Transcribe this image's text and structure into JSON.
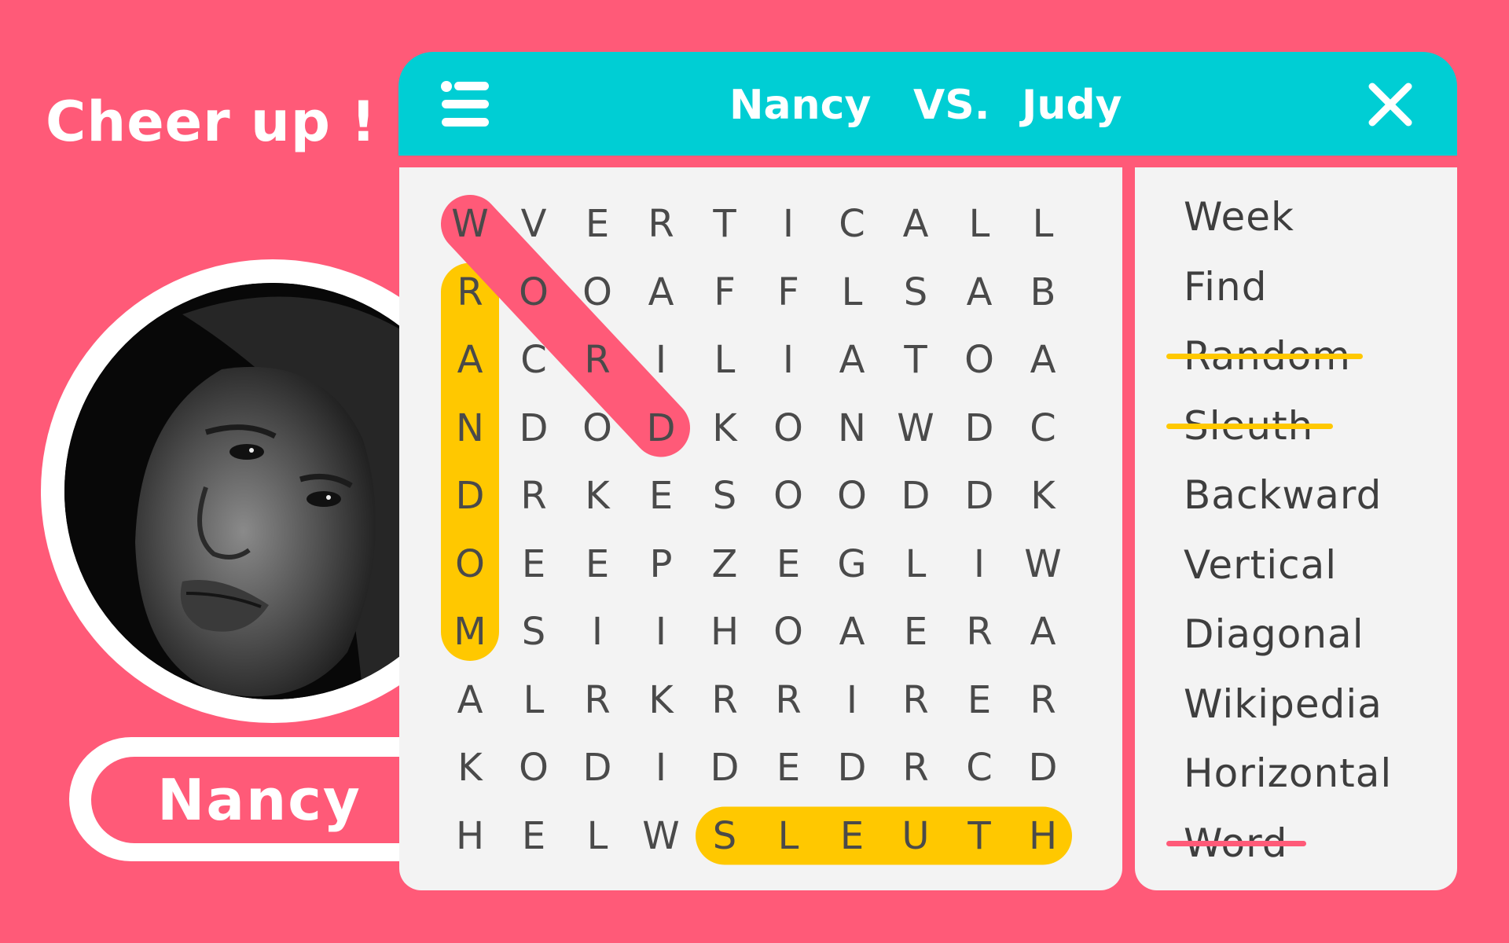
{
  "cheer_text": "Cheer up !",
  "header": {
    "player_one": "Nancy",
    "versus": "VS.",
    "player_two": "Judy"
  },
  "player_card": {
    "name": "Nancy"
  },
  "icons": {
    "menu": "menu-icon",
    "close": "close-icon",
    "avatar": "player-photo"
  },
  "colors": {
    "background": "#ff5a78",
    "header": "#00ced4",
    "panel": "#f3f3f3",
    "highlight_yellow": "#ffc800",
    "highlight_pink": "#ff5a78",
    "letter": "#4a4a4a"
  },
  "grid": [
    [
      "W",
      "V",
      "E",
      "R",
      "T",
      "I",
      "C",
      "A",
      "L",
      "L"
    ],
    [
      "R",
      "O",
      "O",
      "A",
      "F",
      "F",
      "L",
      "S",
      "A",
      "B"
    ],
    [
      "A",
      "C",
      "R",
      "I",
      "L",
      "I",
      "A",
      "T",
      "O",
      "A"
    ],
    [
      "N",
      "D",
      "O",
      "D",
      "K",
      "O",
      "N",
      "W",
      "D",
      "C"
    ],
    [
      "D",
      "R",
      "K",
      "E",
      "S",
      "O",
      "O",
      "D",
      "D",
      "K"
    ],
    [
      "O",
      "E",
      "E",
      "P",
      "Z",
      "E",
      "G",
      "L",
      "I",
      "W"
    ],
    [
      "M",
      "S",
      "I",
      "I",
      "H",
      "O",
      "A",
      "E",
      "R",
      "A"
    ],
    [
      "A",
      "L",
      "R",
      "K",
      "R",
      "R",
      "I",
      "R",
      "E",
      "R"
    ],
    [
      "K",
      "O",
      "D",
      "I",
      "D",
      "E",
      "D",
      "R",
      "C",
      "D"
    ],
    [
      "H",
      "E",
      "L",
      "W",
      "S",
      "L",
      "E",
      "U",
      "T",
      "H"
    ]
  ],
  "highlights": [
    {
      "word": "RANDOM",
      "color": "yellow",
      "from": [
        1,
        0
      ],
      "to": [
        6,
        0
      ]
    },
    {
      "word": "SLEUTH",
      "color": "yellow",
      "from": [
        9,
        4
      ],
      "to": [
        9,
        9
      ]
    },
    {
      "word": "WORD",
      "color": "pink",
      "from": [
        0,
        0
      ],
      "to": [
        3,
        3
      ]
    }
  ],
  "words": [
    {
      "text": "Week",
      "found": false,
      "strike_color": ""
    },
    {
      "text": "Find",
      "found": false,
      "strike_color": ""
    },
    {
      "text": "Random",
      "found": true,
      "strike_color": "yellow"
    },
    {
      "text": "Sleuth",
      "found": true,
      "strike_color": "yellow"
    },
    {
      "text": "Backward",
      "found": false,
      "strike_color": ""
    },
    {
      "text": "Vertical",
      "found": false,
      "strike_color": ""
    },
    {
      "text": "Diagonal",
      "found": false,
      "strike_color": ""
    },
    {
      "text": "Wikipedia",
      "found": false,
      "strike_color": ""
    },
    {
      "text": "Horizontal",
      "found": false,
      "strike_color": ""
    },
    {
      "text": "Word",
      "found": true,
      "strike_color": "pink"
    }
  ]
}
